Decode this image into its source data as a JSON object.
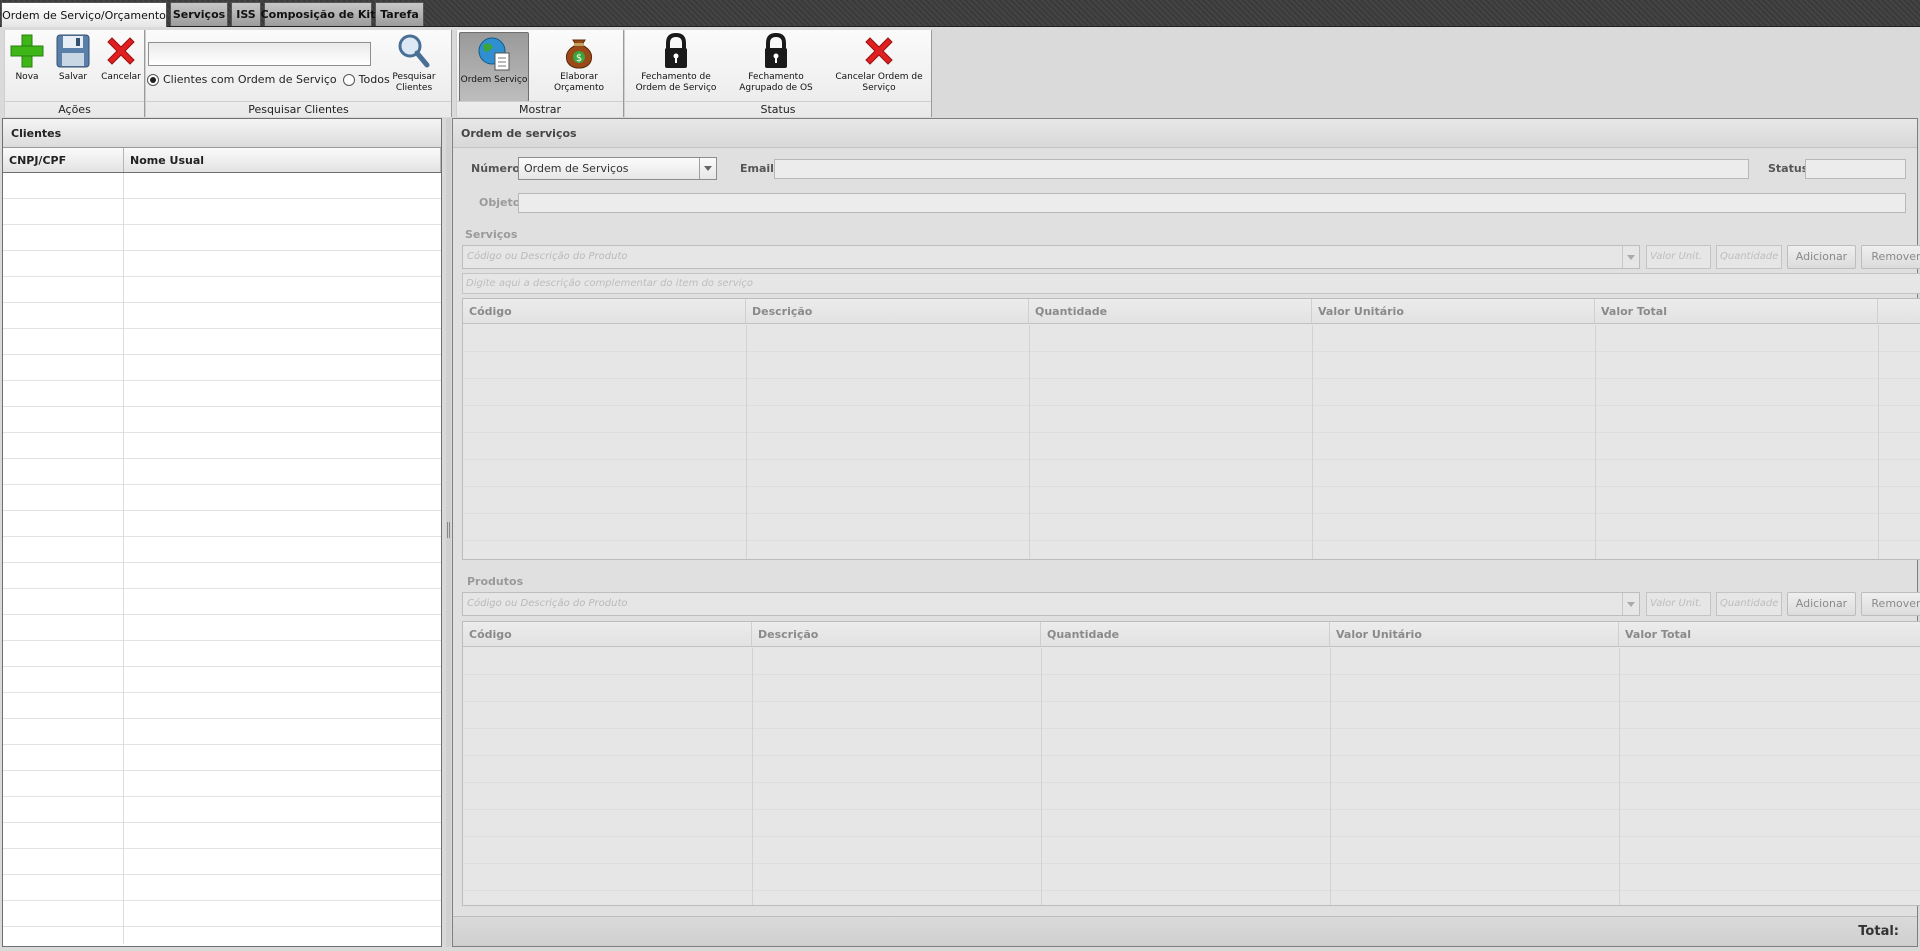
{
  "tabs": [
    {
      "label": "Ordem de Serviço/Orçamento",
      "active": true
    },
    {
      "label": "Serviços",
      "active": false
    },
    {
      "label": "ISS",
      "active": false
    },
    {
      "label": "Composição de Kit",
      "active": false
    },
    {
      "label": "Tarefa",
      "active": false
    }
  ],
  "ribbon": {
    "acoes": {
      "label": "Ações",
      "nova": {
        "label": "Nova",
        "icon": "plus-icon"
      },
      "salvar": {
        "label": "Salvar",
        "icon": "floppy-icon"
      },
      "cancelar": {
        "label": "Cancelar",
        "icon": "x-icon"
      }
    },
    "pesquisar": {
      "label": "Pesquisar Clientes",
      "search_value": "",
      "radio_os": "Clientes com Ordem de Serviço",
      "radio_todos": "Todos",
      "radio_selected": "Clientes com Ordem de Serviço",
      "button": {
        "label": "Pesquisar Clientes",
        "icon": "magnifier-icon"
      }
    },
    "mostrar": {
      "label": "Mostrar",
      "ordem": {
        "label": "Ordem Serviço",
        "icon": "globe-document-icon",
        "pressed": true
      },
      "orcamento": {
        "label": "Elaborar Orçamento",
        "icon": "money-bag-icon"
      }
    },
    "status": {
      "label": "Status",
      "fechamento": {
        "label1": "Fechamento de",
        "label2": "Ordem de Serviço",
        "icon": "lock-icon"
      },
      "agrupado": {
        "label1": "Fechamento",
        "label2": "Agrupado de OS",
        "icon": "lock-icon"
      },
      "cancelar": {
        "label1": "Cancelar Ordem de",
        "label2": "Serviço",
        "icon": "x-icon"
      }
    }
  },
  "clientes": {
    "title": "Clientes",
    "columns": [
      "CNPJ/CPF",
      "Nome Usual"
    ]
  },
  "ordem": {
    "title": "Ordem de serviços",
    "numero_label": "Número",
    "numero_value": "Ordem de Serviços",
    "email_label": "Email",
    "status_label": "Status",
    "objeto_label": "Objeto",
    "servicos": {
      "label": "Serviços",
      "product_placeholder": "Código ou Descrição do Produto",
      "valor_unit_placeholder": "Valor Unit.",
      "quantidade_placeholder": "Quantidade",
      "add_label": "Adicionar",
      "remove_label": "Remover",
      "desc_placeholder": "Digite aqui a descrição complementar do item do serviço",
      "columns": [
        "Código",
        "Descrição",
        "Quantidade",
        "Valor Unitário",
        "Valor Total"
      ]
    },
    "produtos": {
      "label": "Produtos",
      "product_placeholder": "Código ou Descrição do Produto",
      "valor_unit_placeholder": "Valor Unit.",
      "quantidade_placeholder": "Quantidade",
      "add_label": "Adicionar",
      "remove_label": "Remover",
      "columns": [
        "Código",
        "Descrição",
        "Quantidade",
        "Valor Unitário",
        "Valor Total"
      ]
    },
    "total_label": "Total:"
  },
  "colors": {
    "green_plus": "#3fb618",
    "red_x": "#e02020",
    "floppy_blue": "#5a7fa8"
  }
}
